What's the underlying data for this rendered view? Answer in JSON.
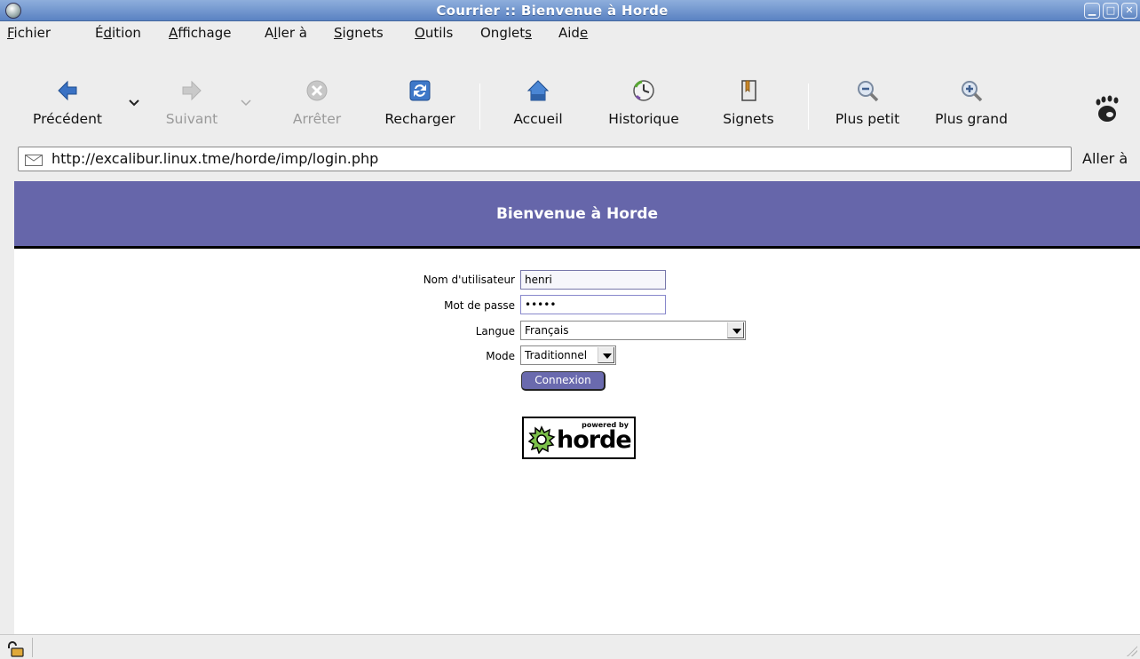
{
  "window": {
    "title": "Courrier :: Bienvenue à Horde"
  },
  "menu": {
    "items": [
      {
        "pre": "",
        "key": "F",
        "post": "ichier"
      },
      {
        "pre": "É",
        "key": "d",
        "post": "ition"
      },
      {
        "pre": "",
        "key": "A",
        "post": "ffichage"
      },
      {
        "pre": "A",
        "key": "l",
        "post": "ler à"
      },
      {
        "pre": "",
        "key": "S",
        "post": "ignets"
      },
      {
        "pre": "",
        "key": "O",
        "post": "utils"
      },
      {
        "pre": "Onglet",
        "key": "s",
        "post": ""
      },
      {
        "pre": "Aid",
        "key": "e",
        "post": ""
      }
    ]
  },
  "toolbar": {
    "back": "Précédent",
    "forward": "Suivant",
    "stop": "Arrêter",
    "reload": "Recharger",
    "home": "Accueil",
    "history": "Historique",
    "bookmarks": "Signets",
    "zoom_out": "Plus petit",
    "zoom_in": "Plus grand"
  },
  "location": {
    "url": "http://excalibur.linux.tme/horde/imp/login.php",
    "go": "Aller à"
  },
  "page": {
    "banner_title": "Bienvenue à Horde",
    "username_label": "Nom d'utilisateur",
    "username_value": "henri",
    "password_label": "Mot de passe",
    "password_value": "•••••",
    "language_label": "Langue",
    "language_value": "Français",
    "mode_label": "Mode",
    "mode_value": "Traditionnel",
    "login_button": "Connexion",
    "logo_powered": "powered by",
    "logo_word": "horde"
  },
  "colors": {
    "banner": "#6666aa",
    "titlebar": "#6f93cd"
  }
}
